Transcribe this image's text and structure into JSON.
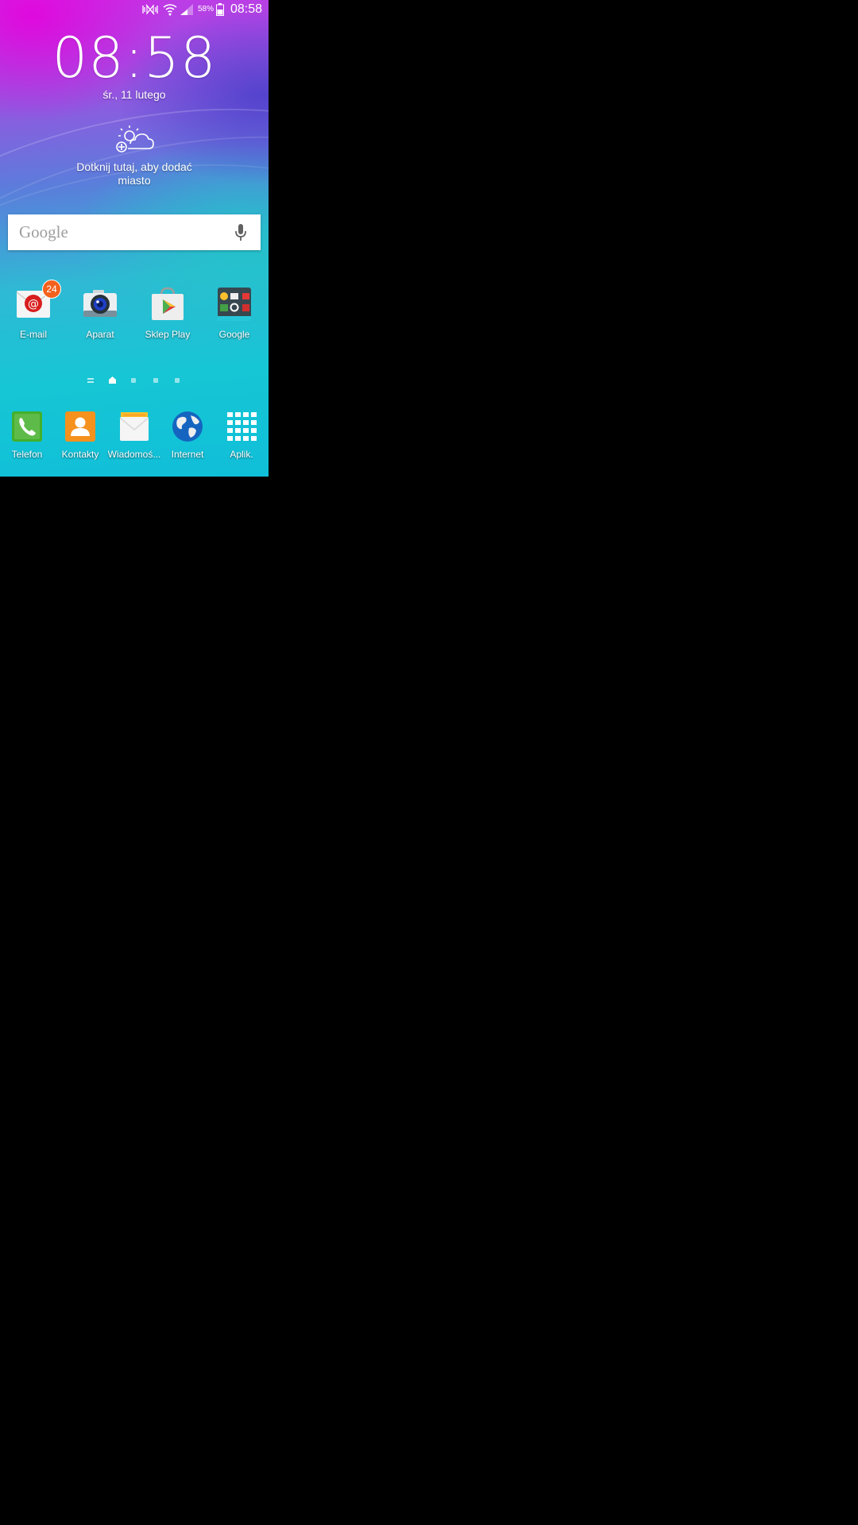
{
  "status_bar": {
    "battery_percent": "58%",
    "time": "08:58",
    "icons": [
      "silent-mode-icon",
      "wifi-icon",
      "signal-icon",
      "battery-icon"
    ]
  },
  "clock_widget": {
    "time": "08:58",
    "date": "śr., 11 lutego",
    "weather_prompt": "Dotknij tutaj, aby dodać miasto"
  },
  "search": {
    "logo": "Google"
  },
  "home_apps": [
    {
      "label": "E-mail",
      "badge": "24"
    },
    {
      "label": "Aparat"
    },
    {
      "label": "Sklep Play"
    },
    {
      "label": "Google"
    }
  ],
  "dock": [
    {
      "label": "Telefon"
    },
    {
      "label": "Kontakty"
    },
    {
      "label": "Wiadomoś..."
    },
    {
      "label": "Internet"
    },
    {
      "label": "Aplik."
    }
  ],
  "page_indicator": {
    "pages": 5,
    "current": 1
  }
}
